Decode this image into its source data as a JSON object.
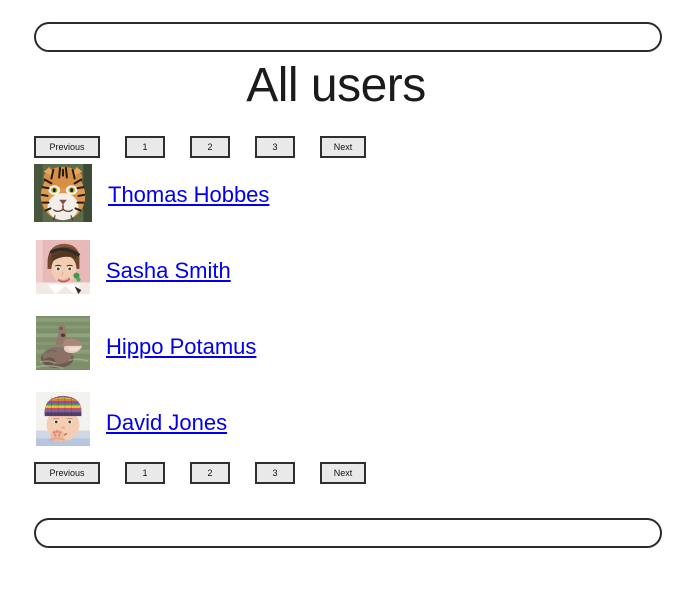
{
  "page": {
    "title": "All users",
    "background_color": "#ffffff",
    "link_color": "#0000ee",
    "button_fill_color": "#e9e9e9",
    "button_border_color": "#2f2f2f"
  },
  "nav_bar": {
    "name": "top-rounded-bar",
    "content": ""
  },
  "footer_bar": {
    "name": "bottom-rounded-bar",
    "content": ""
  },
  "pagination": {
    "previous_label": "Previous",
    "next_label": "Next",
    "pages": [
      "1",
      "2",
      "3"
    ]
  },
  "users": [
    {
      "name": "Thomas Hobbes",
      "avatar_name": "tiger-avatar",
      "avatar_alt": "tiger face photo"
    },
    {
      "name": "Sasha Smith",
      "avatar_name": "woman-portrait-avatar",
      "avatar_alt": "smiling woman with headband photo"
    },
    {
      "name": "Hippo Potamus",
      "avatar_name": "hippo-avatar",
      "avatar_alt": "hippopotamus in water photo"
    },
    {
      "name": "David Jones",
      "avatar_name": "baby-avatar",
      "avatar_alt": "baby wearing striped knit hat photo"
    }
  ]
}
